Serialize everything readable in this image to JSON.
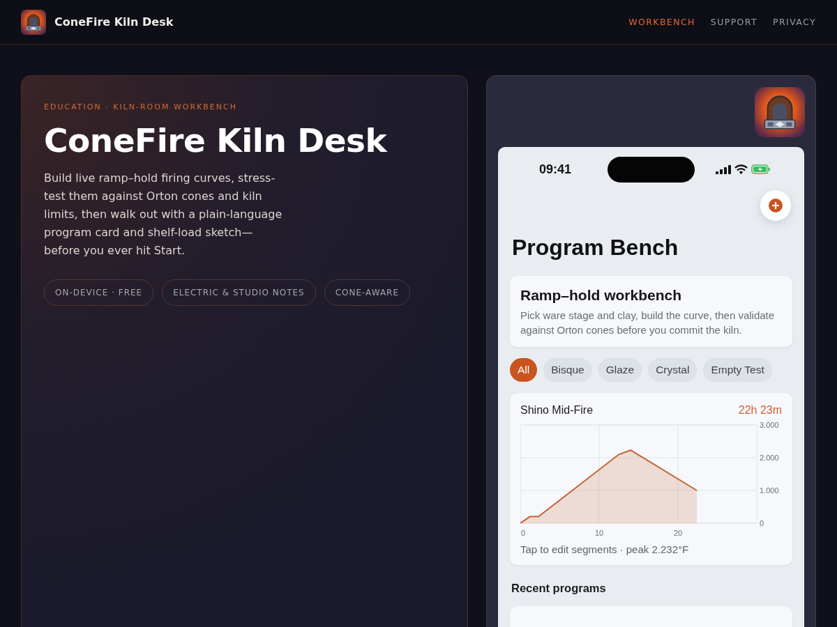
{
  "header": {
    "brand": "ConeFire Kiln Desk",
    "nav": [
      {
        "label": "WORKBENCH",
        "selected": true
      },
      {
        "label": "SUPPORT",
        "selected": false
      },
      {
        "label": "PRIVACY",
        "selected": false
      }
    ]
  },
  "hero": {
    "eyebrow": "EDUCATION · KILN-ROOM WORKBENCH",
    "title": "ConeFire Kiln Desk",
    "description": "Build live ramp–hold firing curves, stress-test them against Orton cones and kiln limits, then walk out with a plain-language program card and shelf-load sketch—before you ever hit Start.",
    "badges": [
      "ON-DEVICE · FREE",
      "ELECTRIC & STUDIO NOTES",
      "CONE-AWARE"
    ]
  },
  "phone": {
    "time": "09:41",
    "title": "Program Bench",
    "intro": {
      "title": "Ramp–hold workbench",
      "text": "Pick ware stage and clay, build the curve, then validate against Orton cones before you commit the kiln."
    },
    "filters": [
      {
        "label": "All",
        "selected": true
      },
      {
        "label": "Bisque",
        "selected": false
      },
      {
        "label": "Glaze",
        "selected": false
      },
      {
        "label": "Crystal",
        "selected": false
      },
      {
        "label": "Empty Test",
        "selected": false
      }
    ],
    "program": {
      "duration": "22h 23m",
      "chart_data": {
        "type": "area",
        "x": [
          0,
          1.2,
          2.3,
          12.5,
          14,
          22.4
        ],
        "series": [
          {
            "name": "Shino Mid-Fire",
            "color": "#c8612e",
            "values": [
              0,
              200,
              200,
              2100,
              2230,
              1000
            ]
          }
        ],
        "grid": true,
        "xlim": [
          0,
          30
        ],
        "ylim": [
          0,
          3000
        ],
        "xticks": [
          0,
          10,
          20
        ],
        "yticks": [
          {
            "value": 0,
            "label": "0"
          },
          {
            "value": 1000,
            "label": "1.000"
          },
          {
            "value": 2000,
            "label": "2.000"
          },
          {
            "value": 3000,
            "label": "3.000"
          }
        ]
      },
      "caption": "Tap to edit segments · peak 2.232°F"
    },
    "recent_heading": "Recent programs"
  }
}
